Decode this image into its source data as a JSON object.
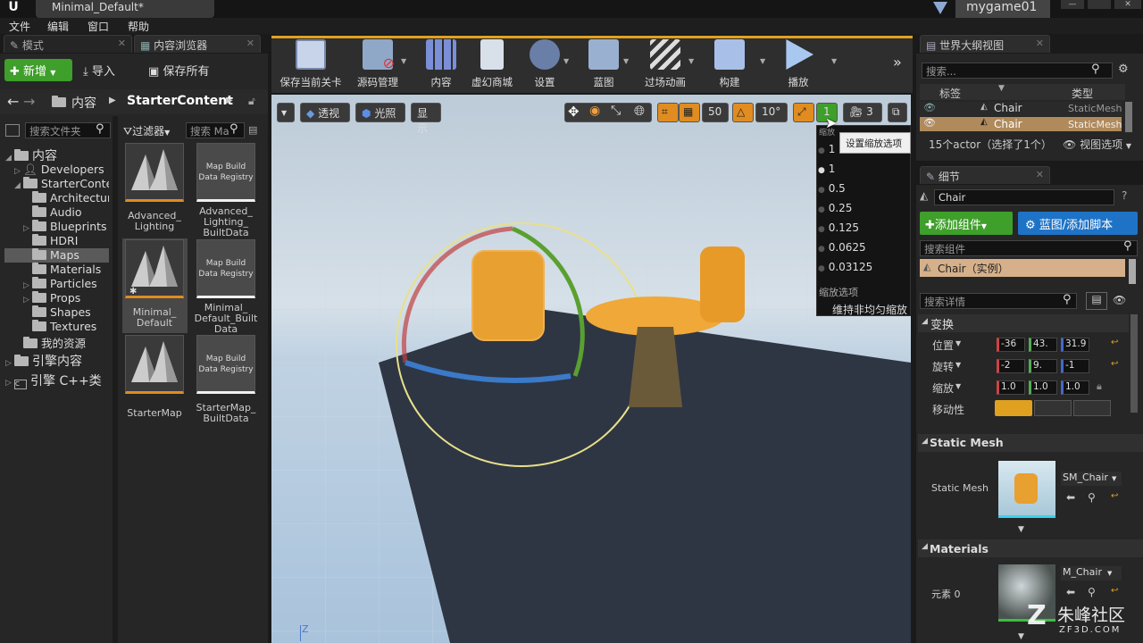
{
  "title_bar": {
    "doc_tab": "Minimal_Default*",
    "project": "mygame01",
    "logo": "ue-logo"
  },
  "menu": [
    "文件",
    "编辑",
    "窗口",
    "帮助"
  ],
  "left_tabs": {
    "modes": "模式",
    "content_browser": "内容浏览器"
  },
  "content_browser": {
    "new_btn": "新增",
    "import_btn": "导入",
    "save_all_btn": "保存所有",
    "path": [
      "内容",
      "StarterContent"
    ],
    "search_folder_placeholder": "搜索文件夹",
    "filter_btn": "过滤器",
    "search_assets_placeholder": "搜索 Ma",
    "tree": {
      "root": "内容",
      "developers": "Developers",
      "starter": "StarterContent",
      "architecture": "Architecture",
      "audio": "Audio",
      "blueprints": "Blueprints",
      "hdri": "HDRI",
      "maps": "Maps",
      "materials": "Materials",
      "particles": "Particles",
      "props": "Props",
      "shapes": "Shapes",
      "textures": "Textures",
      "my_assets": "我的资源",
      "engine_content": "引擎内容",
      "engine_cpp": "引擎 C++类"
    },
    "assets": [
      {
        "label": "Advanced_\nLighting"
      },
      {
        "label": "Advanced_\nLighting_\nBuiltData",
        "inner": "Map Build\nData Registry"
      },
      {
        "label": "Minimal_\nDefault"
      },
      {
        "label": "Minimal_\nDefault_Built\nData",
        "inner": "Map Build\nData Registry"
      },
      {
        "label": "StarterMap"
      },
      {
        "label": "StarterMap_\nBuiltData",
        "inner": "Map Build\nData Registry"
      }
    ]
  },
  "toolbar": [
    "保存当前关卡",
    "源码管理",
    "内容",
    "虚幻商城",
    "设置",
    "蓝图",
    "过场动画",
    "构建",
    "播放"
  ],
  "viewport": {
    "perspective": "透视",
    "lit": "光照",
    "show": "显示",
    "grid_snap": "50",
    "rot_snap": "10°",
    "scale_snap_value": "1",
    "cam_speed": "3",
    "tooltip": "设置缩放选项",
    "scale_header": "缩放",
    "scale_options": [
      "1",
      "0.5",
      "0.25",
      "0.125",
      "0.0625",
      "0.03125"
    ],
    "scale_selected": "1",
    "scale_section": "缩放选项",
    "nonuniform": "维持非均匀缩放",
    "axis_label": "Z"
  },
  "outliner": {
    "tab": "世界大纲视图",
    "search_placeholder": "搜索...",
    "col_label": "标签",
    "col_type": "类型",
    "rows": [
      {
        "label": "Chair",
        "type": "StaticMesh"
      },
      {
        "label": "Chair",
        "type": "StaticMesh"
      }
    ],
    "status": "15个actor（选择了1个）",
    "view_options": "视图选项"
  },
  "details": {
    "tab": "细节",
    "name": "Chair",
    "add_component": "添加组件",
    "blueprint_btn": "蓝图/添加脚本",
    "search_components_placeholder": "搜索组件",
    "component": "Chair（实例）",
    "search_details_placeholder": "搜索详情",
    "transform_section": "变换",
    "location_label": "位置",
    "rotation_label": "旋转",
    "scale_label": "缩放",
    "mobility_label": "移动性",
    "location": [
      "-36",
      "43.",
      "31.9"
    ],
    "rotation": [
      "-2",
      "9.",
      "-1"
    ],
    "scale": [
      "1.0",
      "1.0",
      "1.0"
    ],
    "static_mesh_section": "Static Mesh",
    "static_mesh_label": "Static Mesh",
    "static_mesh_value": "SM_Chair",
    "materials_section": "Materials",
    "element_label": "元素 0",
    "material_value": "M_Chair"
  },
  "watermark": {
    "brand": "朱峰社区",
    "url": "ZF3D.COM"
  },
  "colors": {
    "accent_green": "#3f9f2b",
    "accent_blue": "#1e73c7",
    "highlight_orange": "#e08c20",
    "selected_row": "#b08a5b"
  }
}
